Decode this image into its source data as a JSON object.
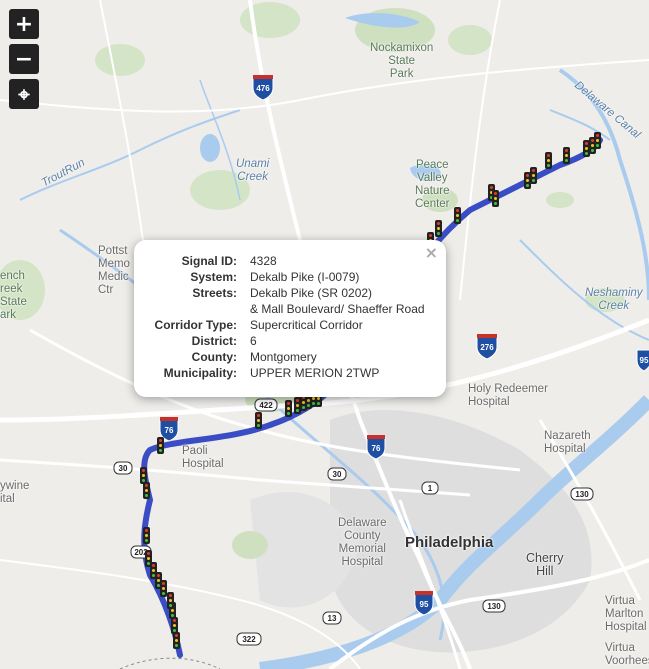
{
  "map": {
    "zoom_in_label": "+",
    "zoom_out_label": "−",
    "locate_label": "⌖",
    "labels": {
      "nockamixon": "Nockamixon\nState\nPark",
      "delaware_canal": "Delaware Canal",
      "trout_run": "TroutRun",
      "unami_creek": "Unami\nCreek",
      "peace_valley": "Peace\nValley\nNature\nCenter",
      "pottstown": "Pottst\nMemo\nMedic\nCtr",
      "french_creek": "ench\nreek\nState\nark",
      "neshaminy": "Neshaminy\nCreek",
      "holy_redeemer": "Holy Redeemer\nHospital",
      "nazareth": "Nazareth\nHospital",
      "paoli": "Paoli\nHospital",
      "brandywine": "ywine\nital",
      "delaware_county": "Delaware\nCounty\nMemorial\nHospital",
      "philadelphia": "Philadelphia",
      "cherry_hill": "Cherry\nHill",
      "virtua_marlton": "Virtua\nMarlton\nHospital",
      "virtua_voorhees": "Virtua\nVoorhees"
    },
    "shields": {
      "i476": "476",
      "i276": "276",
      "i76a": "76",
      "i76b": "76",
      "us422": "422",
      "us30a": "30",
      "us30b": "30",
      "us1": "1",
      "us130a": "130",
      "us130b": "130",
      "us13": "13",
      "i95": "95",
      "us322": "322",
      "i95b": "95",
      "s202": "202"
    }
  },
  "popup": {
    "close_label": "×",
    "rows": [
      {
        "key": "Signal ID:",
        "value": "4328"
      },
      {
        "key": "System:",
        "value": "Dekalb Pike (I-0079)"
      },
      {
        "key": "Streets:",
        "value": "Dekalb Pike (SR 0202)"
      },
      {
        "key": "",
        "value": "& Mall Boulevard/ Shaeffer Road"
      },
      {
        "key": "Corridor Type:",
        "value": "Supercritical Corridor"
      },
      {
        "key": "District:",
        "value": "6"
      },
      {
        "key": "County:",
        "value": "Montgomery"
      },
      {
        "key": "Municipality:",
        "value": "UPPER MERION 2TWP"
      }
    ]
  },
  "colors": {
    "corridor": "#2a3fc0",
    "water": "#a9cbee",
    "park": "#c6dcb4",
    "urban": "#dcdcdc",
    "highway": "#ffffff"
  }
}
